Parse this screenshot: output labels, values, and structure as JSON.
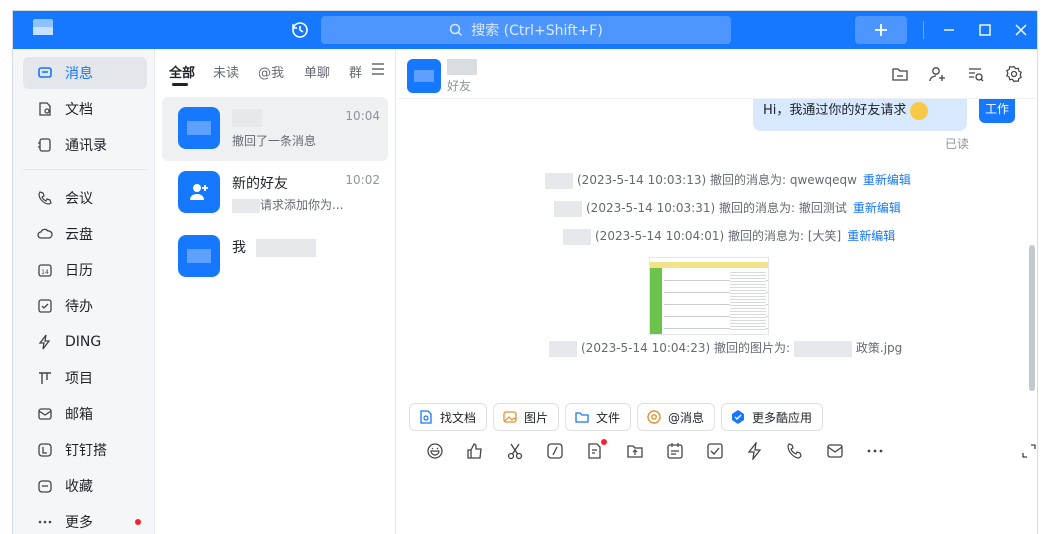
{
  "titlebar": {
    "search_placeholder": "搜索 (Ctrl+Shift+F)",
    "accent": "#1677ff"
  },
  "sidebar": {
    "items": [
      {
        "label": "消息",
        "icon": "message-icon",
        "active": true
      },
      {
        "label": "文档",
        "icon": "document-icon"
      },
      {
        "label": "通讯录",
        "icon": "contacts-icon"
      },
      {
        "label": "会议",
        "icon": "phone-icon"
      },
      {
        "label": "云盘",
        "icon": "cloud-icon"
      },
      {
        "label": "日历",
        "icon": "calendar-icon"
      },
      {
        "label": "待办",
        "icon": "todo-icon"
      },
      {
        "label": "DING",
        "icon": "lightning-icon"
      },
      {
        "label": "项目",
        "icon": "project-icon"
      },
      {
        "label": "邮箱",
        "icon": "mail-icon"
      },
      {
        "label": "钉钉搭",
        "icon": "builder-icon"
      },
      {
        "label": "收藏",
        "icon": "favorite-icon"
      },
      {
        "label": "更多",
        "icon": "more-icon",
        "badge": true
      }
    ]
  },
  "convlist": {
    "tabs": [
      "全部",
      "未读",
      "@我",
      "单聊",
      "群"
    ],
    "conversations": [
      {
        "name": "",
        "time": "10:04",
        "preview": "撤回了一条消息"
      },
      {
        "name": "新的好友",
        "time": "10:02",
        "preview": "请求添加你为..."
      },
      {
        "name": "我",
        "time": "",
        "preview": ""
      }
    ]
  },
  "chat": {
    "subtitle": "好友",
    "bubble_text": "Hi，我通过你的好友请求",
    "self_avatar_text": "工作",
    "read_status": "已读",
    "system_messages": [
      {
        "text": "(2023-5-14 10:03:13) 撤回的消息为: qwewqeqw",
        "link": "重新编辑"
      },
      {
        "text": "(2023-5-14 10:03:31) 撤回的消息为: 撤回测试",
        "link": "重新编辑"
      },
      {
        "text": "(2023-5-14 10:04:01) 撤回的消息为: [大笑]",
        "link": "重新编辑"
      }
    ],
    "image_recall": {
      "prefix": "(2023-5-14 10:04:23) 撤回的图片为:",
      "suffix": "政策.jpg"
    },
    "quick_actions": [
      "找文档",
      "图片",
      "文件",
      "@消息",
      "更多酷应用"
    ]
  }
}
